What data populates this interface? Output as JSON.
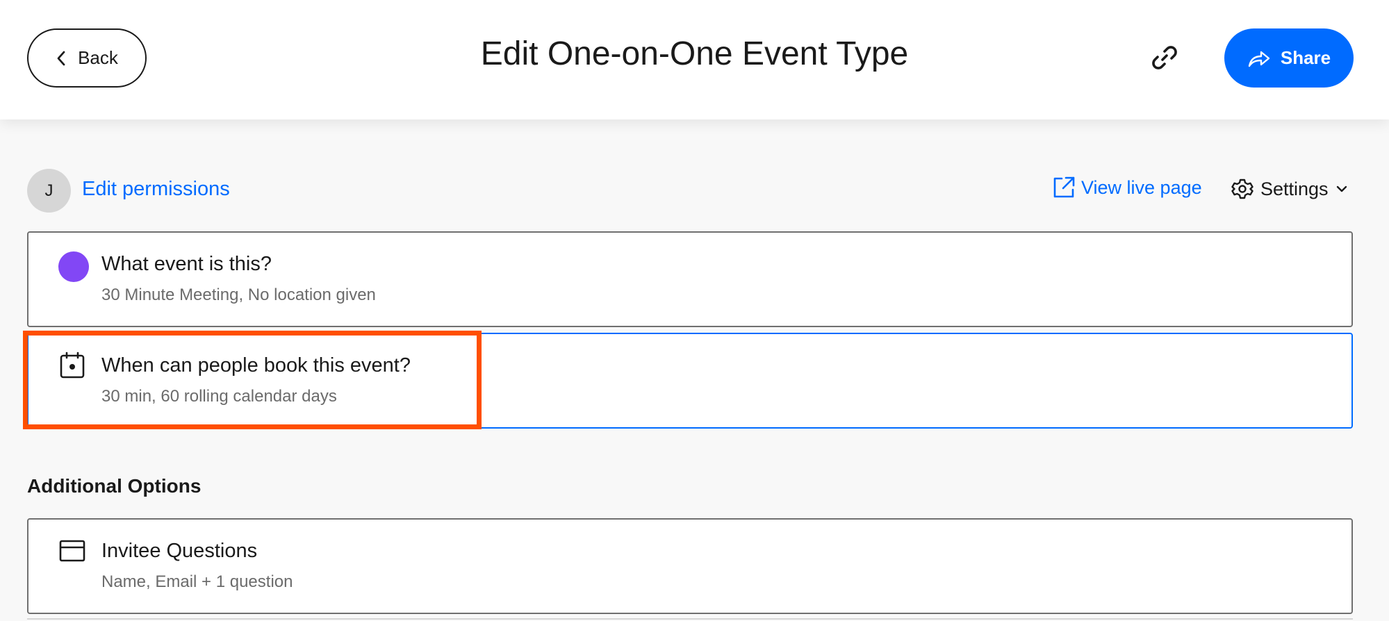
{
  "header": {
    "back_label": "Back",
    "title": "Edit One-on-One Event Type",
    "share_label": "Share",
    "accent_color": "#006bff"
  },
  "toolbar": {
    "avatar_initial": "J",
    "edit_permissions": "Edit permissions",
    "view_live_page": "View live page",
    "settings_label": "Settings"
  },
  "cards": [
    {
      "title": "What event is this?",
      "subtitle": "30 Minute Meeting, No location given",
      "icon": "purple-color-dot",
      "color": "#8247f5"
    },
    {
      "title": "When can people book this event?",
      "subtitle": "30 min, 60 rolling calendar days",
      "icon": "calendar-icon",
      "highlight_color": "#ff4f00"
    }
  ],
  "additional_options": {
    "heading": "Additional Options",
    "items": [
      {
        "title": "Invitee Questions",
        "subtitle": "Name, Email + 1 question",
        "icon": "form-icon"
      }
    ]
  }
}
